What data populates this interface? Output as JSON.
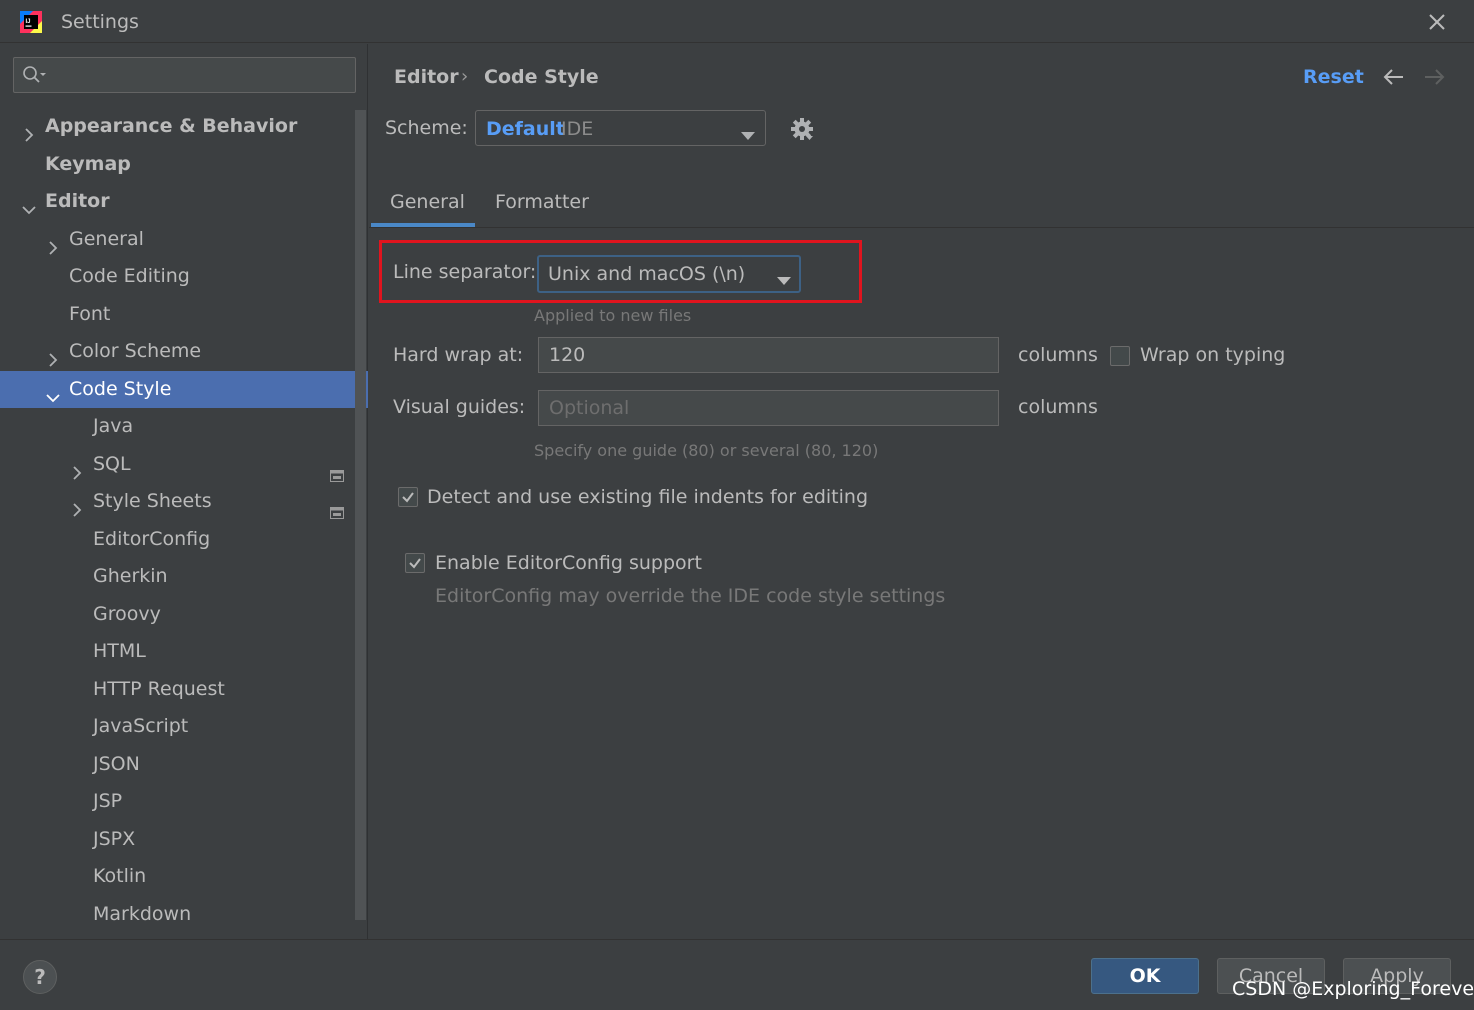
{
  "window": {
    "title": "Settings"
  },
  "sidebar": {
    "search_placeholder": "",
    "items": [
      {
        "label": "Appearance & Behavior",
        "expandable": true,
        "expanded": false,
        "bold": true,
        "level": 0
      },
      {
        "label": "Keymap",
        "expandable": false,
        "bold": true,
        "level": 0
      },
      {
        "label": "Editor",
        "expandable": true,
        "expanded": true,
        "bold": true,
        "level": 0
      },
      {
        "label": "General",
        "expandable": true,
        "expanded": false,
        "level": 1
      },
      {
        "label": "Code Editing",
        "expandable": false,
        "level": 1
      },
      {
        "label": "Font",
        "expandable": false,
        "level": 1
      },
      {
        "label": "Color Scheme",
        "expandable": true,
        "expanded": false,
        "level": 1
      },
      {
        "label": "Code Style",
        "expandable": true,
        "expanded": true,
        "level": 1,
        "selected": true
      },
      {
        "label": "Java",
        "expandable": false,
        "level": 2
      },
      {
        "label": "SQL",
        "expandable": true,
        "expanded": false,
        "level": 2,
        "project_icon": true
      },
      {
        "label": "Style Sheets",
        "expandable": true,
        "expanded": false,
        "level": 2,
        "project_icon": true
      },
      {
        "label": "EditorConfig",
        "expandable": false,
        "level": 2
      },
      {
        "label": "Gherkin",
        "expandable": false,
        "level": 2
      },
      {
        "label": "Groovy",
        "expandable": false,
        "level": 2
      },
      {
        "label": "HTML",
        "expandable": false,
        "level": 2
      },
      {
        "label": "HTTP Request",
        "expandable": false,
        "level": 2
      },
      {
        "label": "JavaScript",
        "expandable": false,
        "level": 2
      },
      {
        "label": "JSON",
        "expandable": false,
        "level": 2
      },
      {
        "label": "JSP",
        "expandable": false,
        "level": 2
      },
      {
        "label": "JSPX",
        "expandable": false,
        "level": 2
      },
      {
        "label": "Kotlin",
        "expandable": false,
        "level": 2
      },
      {
        "label": "Markdown",
        "expandable": false,
        "level": 2
      }
    ]
  },
  "header": {
    "breadcrumb": [
      "Editor",
      "Code Style"
    ],
    "breadcrumb_separator": "›",
    "reset_label": "Reset"
  },
  "scheme": {
    "label": "Scheme:",
    "value": "Default",
    "qualifier": "IDE"
  },
  "tabs": [
    {
      "label": "General",
      "active": true
    },
    {
      "label": "Formatter",
      "active": false
    }
  ],
  "general": {
    "line_separator": {
      "label": "Line separator:",
      "value": "Unix and macOS (\\n)",
      "hint": "Applied to new files"
    },
    "hard_wrap": {
      "label": "Hard wrap at:",
      "value": "120",
      "unit": "columns",
      "wrap_on_typing_label": "Wrap on typing",
      "wrap_on_typing_checked": false
    },
    "visual_guides": {
      "label": "Visual guides:",
      "placeholder": "Optional",
      "unit": "columns",
      "hint": "Specify one guide (80) or several (80, 120)"
    },
    "detect_indents": {
      "label": "Detect and use existing file indents for editing",
      "checked": true
    },
    "editorconfig": {
      "label": "Enable EditorConfig support",
      "checked": true,
      "note": "EditorConfig may override the IDE code style settings"
    }
  },
  "footer": {
    "help_label": "?",
    "ok_label": "OK",
    "cancel_label": "Cancel",
    "apply_label": "Apply",
    "watermark": "CSDN @Exploring_Forever"
  },
  "colors": {
    "accent": "#589df6",
    "selection": "#4b6eaf",
    "highlight_box": "#e0141e",
    "background": "#3c3f41"
  }
}
